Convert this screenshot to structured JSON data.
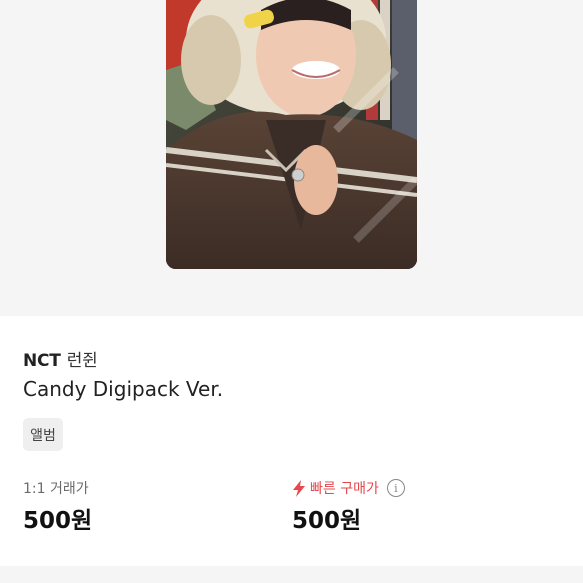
{
  "product": {
    "group": "NCT",
    "member": "런쥔",
    "title": "Candy Digipack Ver.",
    "category_tag": "앨범"
  },
  "pricing": {
    "trade_label": "1:1 거래가",
    "trade_price": "500원",
    "fast_label": "빠른 구매가",
    "fast_price": "500원",
    "info_glyph": "i"
  },
  "colors": {
    "accent_red": "#e5484d",
    "hero_bg": "#f5f5f5"
  }
}
